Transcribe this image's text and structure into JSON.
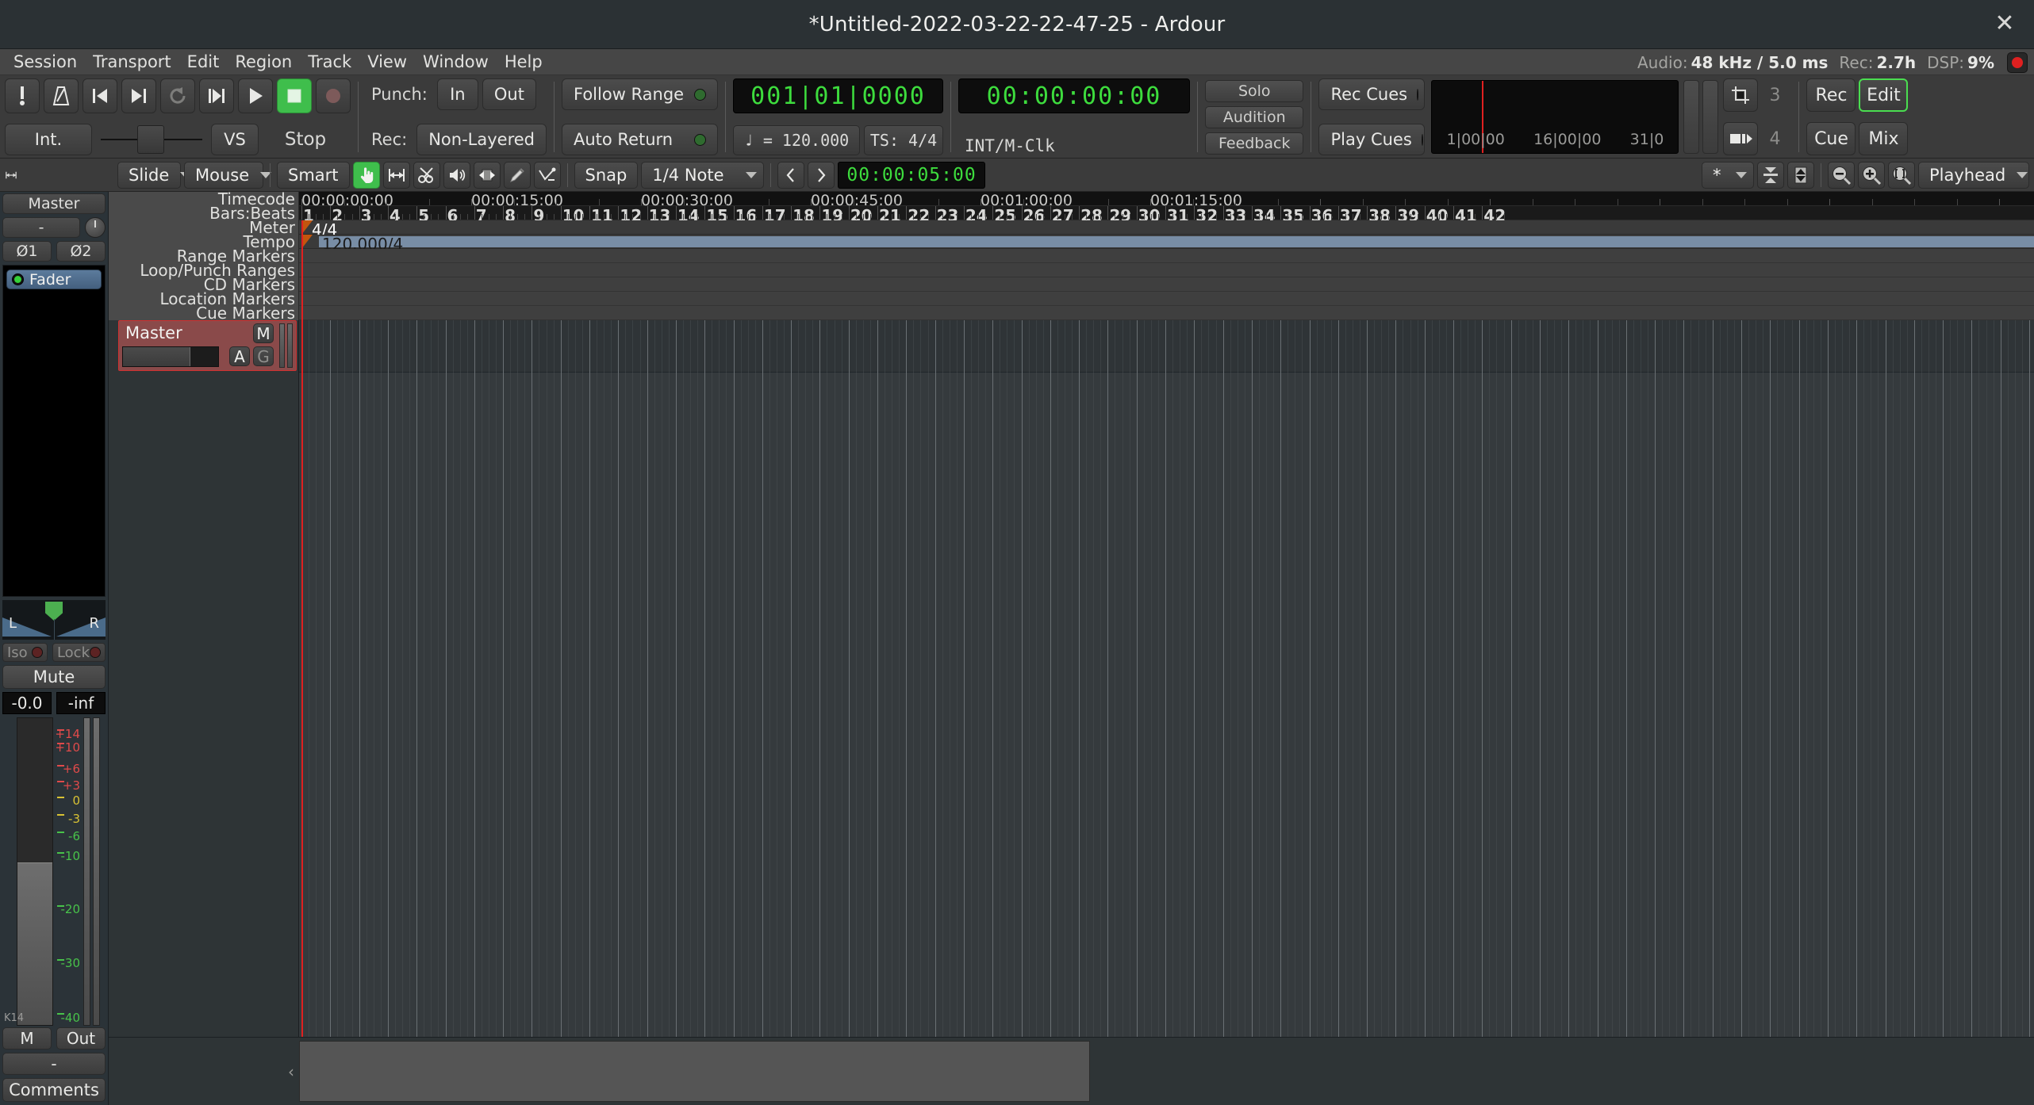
{
  "window": {
    "title": "*Untitled-2022-03-22-22-47-25 - Ardour",
    "close_icon": "close-icon"
  },
  "menubar": {
    "items": [
      "Session",
      "Transport",
      "Edit",
      "Region",
      "Track",
      "View",
      "Window",
      "Help"
    ],
    "status": {
      "audio_label": "Audio:",
      "audio_value": "48 kHz / 5.0 ms",
      "rec_label": "Rec:",
      "rec_value": "2.7h",
      "dsp_label": "DSP:",
      "dsp_value": "9%"
    }
  },
  "transport": {
    "buttons": [
      {
        "name": "midi-panic-button",
        "icon": "exclamation-icon"
      },
      {
        "name": "metronome-button",
        "icon": "metronome-icon"
      },
      {
        "name": "goto-start-button",
        "icon": "skip-start-icon"
      },
      {
        "name": "goto-end-button",
        "icon": "skip-end-icon"
      },
      {
        "name": "loop-button",
        "icon": "loop-icon"
      },
      {
        "name": "play-range-button",
        "icon": "play-range-icon"
      },
      {
        "name": "play-button",
        "icon": "play-icon"
      },
      {
        "name": "stop-button",
        "icon": "stop-icon"
      },
      {
        "name": "record-button",
        "icon": "record-icon"
      }
    ],
    "sync_source": "Int.",
    "vs_label": "VS",
    "transport_state": "Stop",
    "punch_label": "Punch:",
    "punch_in": "In",
    "punch_out": "Out",
    "rec_label": "Rec:",
    "rec_mode": "Non-Layered",
    "follow_range": "Follow Range",
    "auto_return": "Auto Return",
    "primary_clock": "001|01|0000",
    "secondary_clock": "00:00:00:00",
    "tempo": "♩ = 120.000",
    "time_signature": "TS:  4/4",
    "clock_sync_label": "INT/M-Clk",
    "solo": "Solo",
    "audition": "Audition",
    "feedback": "Feedback",
    "rec_cues": "Rec Cues",
    "play_cues": "Play Cues",
    "mini_timeline": {
      "labels": [
        "1|00|00",
        "16|00|00",
        "31|0"
      ]
    },
    "monitor_nums": [
      "3",
      "4"
    ],
    "page_buttons": [
      "Rec",
      "Edit",
      "Cue",
      "Mix"
    ],
    "active_page": "Edit"
  },
  "edit_toolbar": {
    "edit_mode": "Slide",
    "edit_point": "Mouse",
    "smart_label": "Smart",
    "tools": [
      {
        "name": "grab-tool",
        "icon": "hand-icon",
        "active": true
      },
      {
        "name": "range-tool",
        "icon": "range-icon",
        "active": false
      },
      {
        "name": "cut-tool",
        "icon": "scissors-icon",
        "active": false
      },
      {
        "name": "audition-tool",
        "icon": "speaker-icon",
        "active": false
      },
      {
        "name": "stretch-tool",
        "icon": "stretch-icon",
        "active": false
      },
      {
        "name": "draw-tool",
        "icon": "pencil-icon",
        "active": false
      },
      {
        "name": "edit-automation-tool",
        "icon": "automation-icon",
        "active": false
      }
    ],
    "snap_label": "Snap",
    "grid_value": "1/4 Note",
    "nudge_prev": "‹",
    "nudge_next": "›",
    "nudge_clock": "00:00:05:00",
    "marker_dropdown": "*",
    "zoom_focus": "Playhead"
  },
  "mixer_strip": {
    "name": "Master",
    "input_button": "-",
    "phase_buttons": [
      "Ø1",
      "Ø2"
    ],
    "processors": [
      {
        "name": "Fader",
        "active": true
      }
    ],
    "pan_left": "L",
    "pan_right": "R",
    "iso_label": "Iso",
    "lock_label": "Lock",
    "mute_label": "Mute",
    "gain_value": "-0.0",
    "peak_value": "-inf",
    "meter_ticks": [
      "+14",
      "+10",
      "+6",
      "+3",
      "0",
      "-3",
      "-6",
      "-10",
      "-20",
      "-30",
      "-40"
    ],
    "meter_point": "K14",
    "metering_m": "M",
    "output_label": "Out",
    "output_value": "-",
    "comments_label": "Comments"
  },
  "rulers": {
    "names": [
      "Timecode",
      "Bars:Beats",
      "Meter",
      "Tempo",
      "Range Markers",
      "Loop/Punch Ranges",
      "CD Markers",
      "Location Markers",
      "Cue Markers"
    ],
    "timecode_labels": [
      "00:00:00:00",
      "00:00:15:00",
      "00:00:30:00",
      "00:00:45:00",
      "00:01:00:00",
      "00:01:15:00"
    ],
    "bar_numbers": [
      "1",
      "2",
      "3",
      "4",
      "5",
      "6",
      "7",
      "8",
      "9",
      "10",
      "11",
      "12",
      "13",
      "14",
      "15",
      "16",
      "17",
      "18",
      "19",
      "20",
      "21",
      "22",
      "23",
      "24",
      "25",
      "26",
      "27",
      "28",
      "29",
      "30",
      "31",
      "32",
      "33",
      "34",
      "35",
      "36",
      "37",
      "38",
      "39",
      "40",
      "41",
      "42"
    ],
    "meter_value": "4/4",
    "tempo_value": "120.000/4"
  },
  "tracks": [
    {
      "name": "Master",
      "mute_button": "M",
      "automation_button": "A",
      "group_button": "G"
    }
  ],
  "colors": {
    "accent_green": "#3fbe4c",
    "clock_green": "#3ddc3d",
    "playhead_red": "#e02020",
    "master_track": "#8a4a4a",
    "marker_orange": "#c2560e",
    "tempo_band": "#8ea9c9"
  }
}
